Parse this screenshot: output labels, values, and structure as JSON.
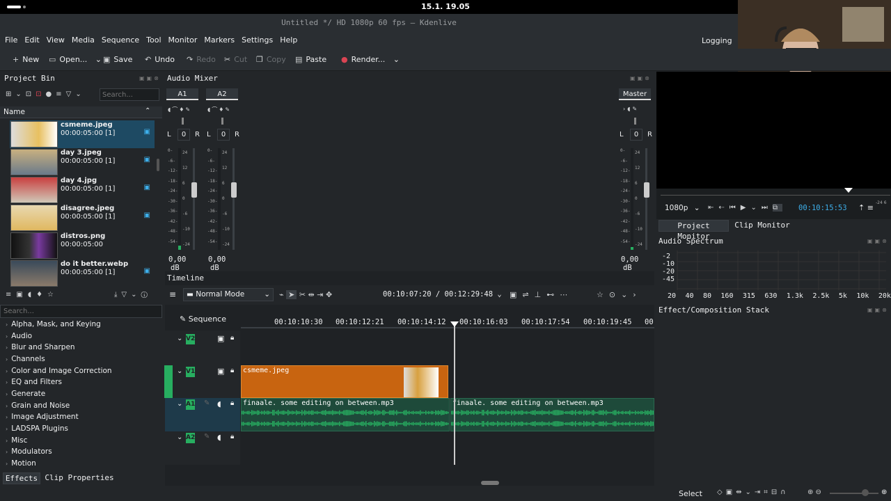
{
  "system": {
    "clock": "15.1. 19.05"
  },
  "window": {
    "title": "Untitled */ HD 1080p 60 fps — Kdenlive"
  },
  "menu": [
    "File",
    "Edit",
    "View",
    "Media",
    "Sequence",
    "Tool",
    "Monitor",
    "Markers",
    "Settings",
    "Help"
  ],
  "logging": "Logging",
  "toolbar": {
    "new": "New",
    "open": "Open...",
    "save": "Save",
    "undo": "Undo",
    "redo": "Redo",
    "cut": "Cut",
    "copy": "Copy",
    "paste": "Paste",
    "render": "Render..."
  },
  "project_bin": {
    "title": "Project Bin",
    "search_placeholder": "Search...",
    "column": "Name",
    "items": [
      {
        "name": "csmeme.jpeg",
        "duration": "00:00:05:00 [1]"
      },
      {
        "name": "day 3.jpeg",
        "duration": "00:00:05:00 [1]"
      },
      {
        "name": "day 4.jpg",
        "duration": "00:00:05:00 [1]"
      },
      {
        "name": "disagree.jpeg",
        "duration": "00:00:05:00 [1]"
      },
      {
        "name": "distros.png",
        "duration": "00:00:05:00"
      },
      {
        "name": "do it better.webp",
        "duration": "00:00:05:00 [1]"
      }
    ]
  },
  "effects": {
    "search_placeholder": "Search...",
    "categories": [
      "Alpha, Mask, and Keying",
      "Audio",
      "Blur and Sharpen",
      "Channels",
      "Color and Image Correction",
      "EQ and Filters",
      "Generate",
      "Grain and Noise",
      "Image Adjustment",
      "LADSPA Plugins",
      "Misc",
      "Modulators",
      "Motion"
    ],
    "tabs": [
      "Effects",
      "Clip Properties"
    ]
  },
  "mixer": {
    "title": "Audio Mixer",
    "strips": [
      {
        "name": "A1",
        "pan": "0",
        "db": "0,00",
        "unit": "dB",
        "level": 0.04
      },
      {
        "name": "A2",
        "pan": "0",
        "db": "0,00",
        "unit": "dB",
        "level": 0
      },
      {
        "name": "Master",
        "pan": "0",
        "db": "0,00",
        "unit": "dB",
        "level": 0.03
      }
    ],
    "pan_l": "L",
    "pan_r": "R",
    "scale_left": [
      "0-",
      "-6-",
      "-12-",
      "-18-",
      "-24-",
      "-30-",
      "-36-",
      "-42-",
      "-48-",
      "-54-"
    ],
    "scale_right": [
      "24",
      "12",
      "6",
      "0",
      "-6",
      "-10",
      "-24"
    ]
  },
  "timeline": {
    "title": "Timeline",
    "mode": "Normal Mode",
    "timecode": "00:10:07:20 / 00:12:29:48",
    "sequence": "Sequence",
    "ruler": [
      "00:10:10:30",
      "00:10:12:21",
      "00:10:14:12",
      "00:10:16:03",
      "00:10:17:54",
      "00:10:19:45",
      "00"
    ],
    "tracks": [
      "V2",
      "V1",
      "A1",
      "A2"
    ],
    "clips": {
      "video": "csmeme.jpeg",
      "audio1": "finaale. some editing on between.mp3",
      "audio2": "finaale. some editing on between.mp3"
    }
  },
  "monitor": {
    "resolution": "1080p",
    "timecode": "00:10:15:53",
    "tabs": [
      "Project Monitor",
      "Clip Monitor"
    ]
  },
  "spectrum": {
    "title": "Audio Spectrum",
    "y": [
      "-2",
      "-10",
      "-20",
      "-45"
    ],
    "x": [
      "20",
      "40",
      "80",
      "160",
      "315",
      "630",
      "1.3k",
      "2.5k",
      "5k",
      "10k",
      "20k"
    ]
  },
  "effect_stack": {
    "title": "Effect/Composition Stack"
  },
  "status": {
    "select": "Select"
  }
}
